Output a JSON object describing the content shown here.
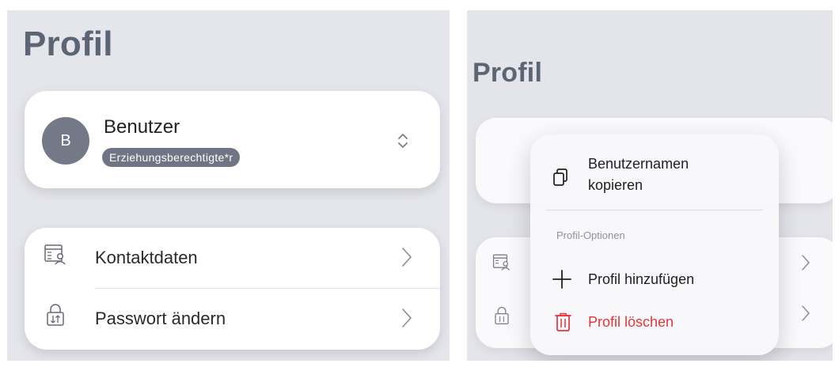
{
  "left": {
    "title": "Profil",
    "user": {
      "avatar_letter": "B",
      "name": "Benutzer",
      "role": "Erziehungsberechtigte*r",
      "switch_icon": "chevron-up-down-icon"
    },
    "list": [
      {
        "label": "Kontaktdaten",
        "icon": "contact-card-icon"
      },
      {
        "label": "Passwort ändern",
        "icon": "lock-arrows-icon"
      }
    ]
  },
  "right": {
    "title": "Profil",
    "menu": {
      "copy_label": "Benutzernamen kopieren",
      "section_label": "Profil-Optionen",
      "add_label": "Profil hinzufügen",
      "delete_label": "Profil löschen"
    }
  },
  "colors": {
    "background": "#e5e6ec",
    "title": "#5c6573",
    "avatar": "#737986",
    "badge": "#6f7583",
    "destructive": "#e3363a"
  }
}
